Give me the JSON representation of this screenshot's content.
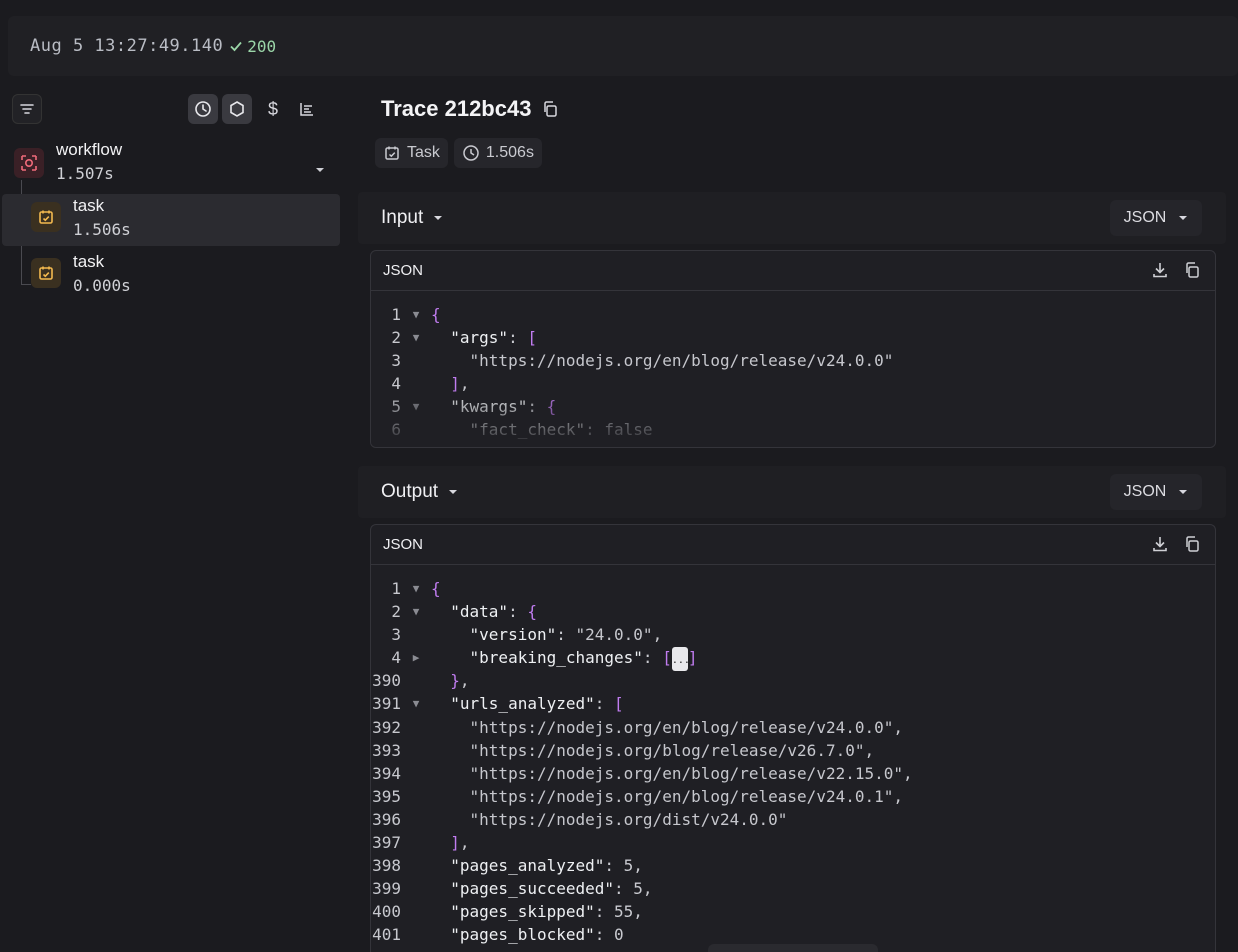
{
  "topbar": {
    "timestamp": "Aug 5 13:27:49.140",
    "status_code": "200"
  },
  "sidebar": {
    "toolbar": [
      "filter-icon",
      "clock-icon",
      "hexagon-icon",
      "dollar-icon",
      "chart-icon"
    ],
    "tree": [
      {
        "name": "workflow",
        "duration": "1.507s",
        "icon": "workflow-icon"
      },
      {
        "name": "task",
        "duration": "1.506s",
        "icon": "task-icon",
        "selected": true
      },
      {
        "name": "task",
        "duration": "0.000s",
        "icon": "task-icon"
      }
    ]
  },
  "main": {
    "title": "Trace 212bc43",
    "chips": {
      "type": "Task",
      "duration": "1.506s"
    },
    "input": {
      "label": "Input",
      "format": "JSON",
      "panel_title": "JSON",
      "lines": [
        {
          "n": "1",
          "fold": "▼",
          "parts": [
            [
              "p",
              "{"
            ]
          ]
        },
        {
          "n": "2",
          "fold": "▼",
          "parts": [
            [
              "t",
              "  "
            ],
            [
              "k",
              "\"args\""
            ],
            [
              "t",
              ": "
            ],
            [
              "p",
              "["
            ]
          ]
        },
        {
          "n": "3",
          "fold": "",
          "parts": [
            [
              "t",
              "    "
            ],
            [
              "s",
              "\"https://nodejs.org/en/blog/release/v24.0.0\""
            ]
          ]
        },
        {
          "n": "4",
          "fold": "",
          "parts": [
            [
              "t",
              "  "
            ],
            [
              "p",
              "]"
            ],
            [
              "t",
              ","
            ]
          ]
        },
        {
          "n": "5",
          "fold": "▼",
          "parts": [
            [
              "t",
              "  "
            ],
            [
              "k",
              "\"kwargs\""
            ],
            [
              "t",
              ": "
            ],
            [
              "p",
              "{"
            ]
          ]
        },
        {
          "n": "6",
          "fold": "",
          "parts": [
            [
              "t",
              "    "
            ],
            [
              "k",
              "\"fact_check\""
            ],
            [
              "t",
              ": false"
            ]
          ]
        }
      ]
    },
    "output": {
      "label": "Output",
      "format": "JSON",
      "panel_title": "JSON",
      "lines": [
        {
          "n": "1",
          "fold": "▼",
          "parts": [
            [
              "p",
              "{"
            ]
          ]
        },
        {
          "n": "2",
          "fold": "▼",
          "parts": [
            [
              "t",
              "  "
            ],
            [
              "k",
              "\"data\""
            ],
            [
              "t",
              ": "
            ],
            [
              "p",
              "{"
            ]
          ]
        },
        {
          "n": "3",
          "fold": "",
          "parts": [
            [
              "t",
              "    "
            ],
            [
              "k",
              "\"version\""
            ],
            [
              "t",
              ": "
            ],
            [
              "s",
              "\"24.0.0\""
            ],
            [
              "t",
              ","
            ]
          ]
        },
        {
          "n": "4",
          "fold": "▶",
          "parts": [
            [
              "t",
              "    "
            ],
            [
              "k",
              "\"breaking_changes\""
            ],
            [
              "t",
              ": "
            ],
            [
              "p",
              "["
            ],
            [
              "e",
              "..."
            ],
            [
              "p",
              "]"
            ]
          ]
        },
        {
          "n": "390",
          "fold": "",
          "parts": [
            [
              "t",
              "  "
            ],
            [
              "p",
              "}"
            ],
            [
              "t",
              ","
            ]
          ]
        },
        {
          "n": "391",
          "fold": "▼",
          "parts": [
            [
              "t",
              "  "
            ],
            [
              "k",
              "\"urls_analyzed\""
            ],
            [
              "t",
              ": "
            ],
            [
              "p",
              "["
            ]
          ]
        },
        {
          "n": "392",
          "fold": "",
          "parts": [
            [
              "t",
              "    "
            ],
            [
              "s",
              "\"https://nodejs.org/en/blog/release/v24.0.0\""
            ],
            [
              "t",
              ","
            ]
          ]
        },
        {
          "n": "393",
          "fold": "",
          "parts": [
            [
              "t",
              "    "
            ],
            [
              "s",
              "\"https://nodejs.org/blog/release/v26.7.0\""
            ],
            [
              "t",
              ","
            ]
          ]
        },
        {
          "n": "394",
          "fold": "",
          "parts": [
            [
              "t",
              "    "
            ],
            [
              "s",
              "\"https://nodejs.org/en/blog/release/v22.15.0\""
            ],
            [
              "t",
              ","
            ]
          ]
        },
        {
          "n": "395",
          "fold": "",
          "parts": [
            [
              "t",
              "    "
            ],
            [
              "s",
              "\"https://nodejs.org/en/blog/release/v24.0.1\""
            ],
            [
              "t",
              ","
            ]
          ]
        },
        {
          "n": "396",
          "fold": "",
          "parts": [
            [
              "t",
              "    "
            ],
            [
              "s",
              "\"https://nodejs.org/dist/v24.0.0\""
            ]
          ]
        },
        {
          "n": "397",
          "fold": "",
          "parts": [
            [
              "t",
              "  "
            ],
            [
              "p",
              "]"
            ],
            [
              "t",
              ","
            ]
          ]
        },
        {
          "n": "398",
          "fold": "",
          "parts": [
            [
              "t",
              "  "
            ],
            [
              "k",
              "\"pages_analyzed\""
            ],
            [
              "t",
              ": 5,"
            ]
          ]
        },
        {
          "n": "399",
          "fold": "",
          "parts": [
            [
              "t",
              "  "
            ],
            [
              "k",
              "\"pages_succeeded\""
            ],
            [
              "t",
              ": 5,"
            ]
          ]
        },
        {
          "n": "400",
          "fold": "",
          "parts": [
            [
              "t",
              "  "
            ],
            [
              "k",
              "\"pages_skipped\""
            ],
            [
              "t",
              ": 55,"
            ]
          ]
        },
        {
          "n": "401",
          "fold": "",
          "parts": [
            [
              "t",
              "  "
            ],
            [
              "k",
              "\"pages_blocked\""
            ],
            [
              "t",
              ": 0"
            ]
          ]
        }
      ]
    }
  },
  "colors": {
    "accent_purple": "#c07cf0",
    "status_ok": "#9bd6a8",
    "task_icon": "#f3b94f",
    "workflow_icon": "#ef6b7a"
  }
}
